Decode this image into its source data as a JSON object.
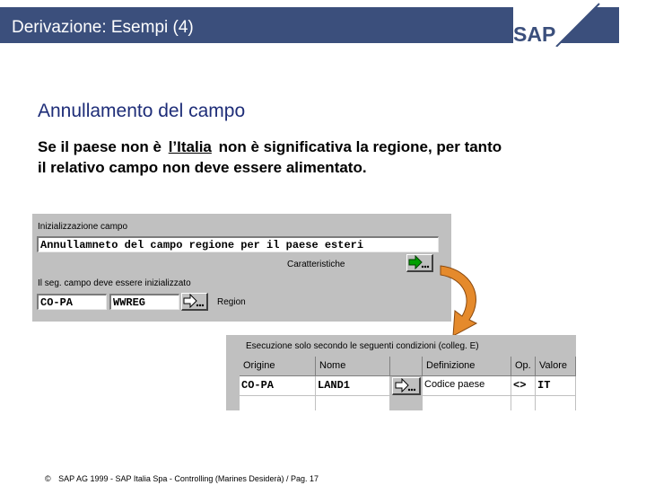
{
  "header": {
    "title": "Derivazione: Esempi (4)",
    "logo_text": "SAP"
  },
  "section_title": "Annullamento del campo",
  "body": {
    "before": "Se il paese non è",
    "field": "l’Italia",
    "after": "non è significativa la regione, per tanto il relativo campo non deve essere alimentato."
  },
  "panel1": {
    "init_label": "Inizializzazione campo",
    "init_value": "Annullamneto del campo regione per il paese esteri",
    "characteristics_label": "Caratteristiche",
    "seg_label": "Il seg. campo deve essere inizializzato",
    "field1_value": "CO-PA",
    "field2_value": "WWREG",
    "region_label": "Region"
  },
  "panel2": {
    "title": "Esecuzione solo secondo le seguenti condizioni (colleg. E)",
    "columns": [
      "Origine",
      "Nome",
      "",
      "Definizione",
      "Op.",
      "Valore"
    ],
    "row": {
      "origine": "CO-PA",
      "nome": "LAND1",
      "definizione": "Codice paese",
      "op": "<>",
      "valore": "IT"
    }
  },
  "footer": {
    "copyright_symbol": "©",
    "text": "SAP AG 1999 - SAP Italia Spa - Controlling (Marines Desiderà) / Pag. 17"
  },
  "colors": {
    "header_bar": "#3b4f7c",
    "title_blue": "#1e2d78",
    "dialog_gray": "#c0c0c0",
    "arrow_orange": "#e58a2c",
    "button_arrow_green": "#00a000"
  }
}
